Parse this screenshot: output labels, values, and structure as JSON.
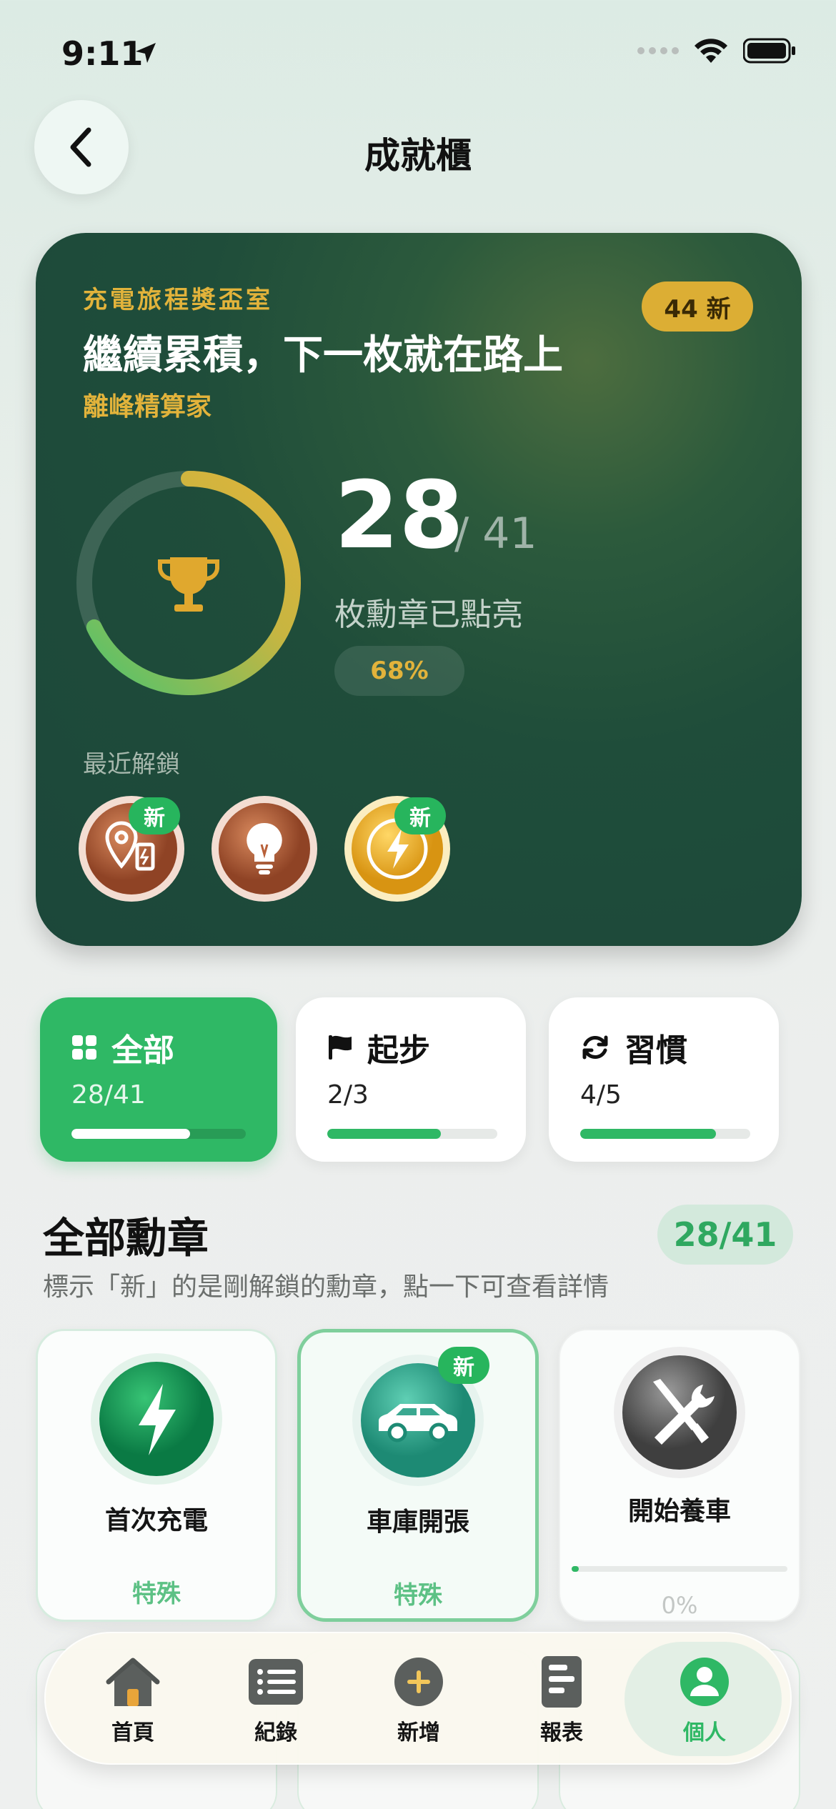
{
  "status": {
    "time": "9:11"
  },
  "nav": {
    "title": "成就櫃"
  },
  "hero": {
    "subtitle": "充電旅程獎盃室",
    "title": "繼續累積，下一枚就在路上",
    "honor": "離峰精算家",
    "new_badge": "44 新",
    "unlocked": "28",
    "total": "/ 41",
    "unlocked_label": "枚勳章已點亮",
    "percent": "68%",
    "progress_fraction": 0.68,
    "recent_label": "最近解鎖",
    "new_tag": "新"
  },
  "filters": [
    {
      "label": "全部",
      "count": "28/41",
      "fraction": 0.68
    },
    {
      "label": "起步",
      "count": "2/3",
      "fraction": 0.667
    },
    {
      "label": "習慣",
      "count": "4/5",
      "fraction": 0.8
    }
  ],
  "section": {
    "title": "全部勳章",
    "count": "28/41",
    "description": "標示「新」的是剛解鎖的勳章，點一下可查看詳情"
  },
  "badges": [
    {
      "name": "首次充電",
      "category": "特殊",
      "icon": "lightning-icon"
    },
    {
      "name": "車庫開張",
      "category": "特殊",
      "icon": "car-icon",
      "tag": "新"
    },
    {
      "name": "開始養車",
      "progress": "0%",
      "icon": "wrench-screwdriver-icon"
    }
  ],
  "tabbar": [
    {
      "label": "首頁",
      "icon": "home-icon"
    },
    {
      "label": "紀錄",
      "icon": "list-icon"
    },
    {
      "label": "新增",
      "icon": "plus-circle-icon"
    },
    {
      "label": "報表",
      "icon": "report-icon"
    },
    {
      "label": "個人",
      "icon": "person-icon"
    }
  ],
  "colors": {
    "accent": "#2fb865",
    "gold": "#e2b33b",
    "hero_bg": "#1f4d3a"
  }
}
